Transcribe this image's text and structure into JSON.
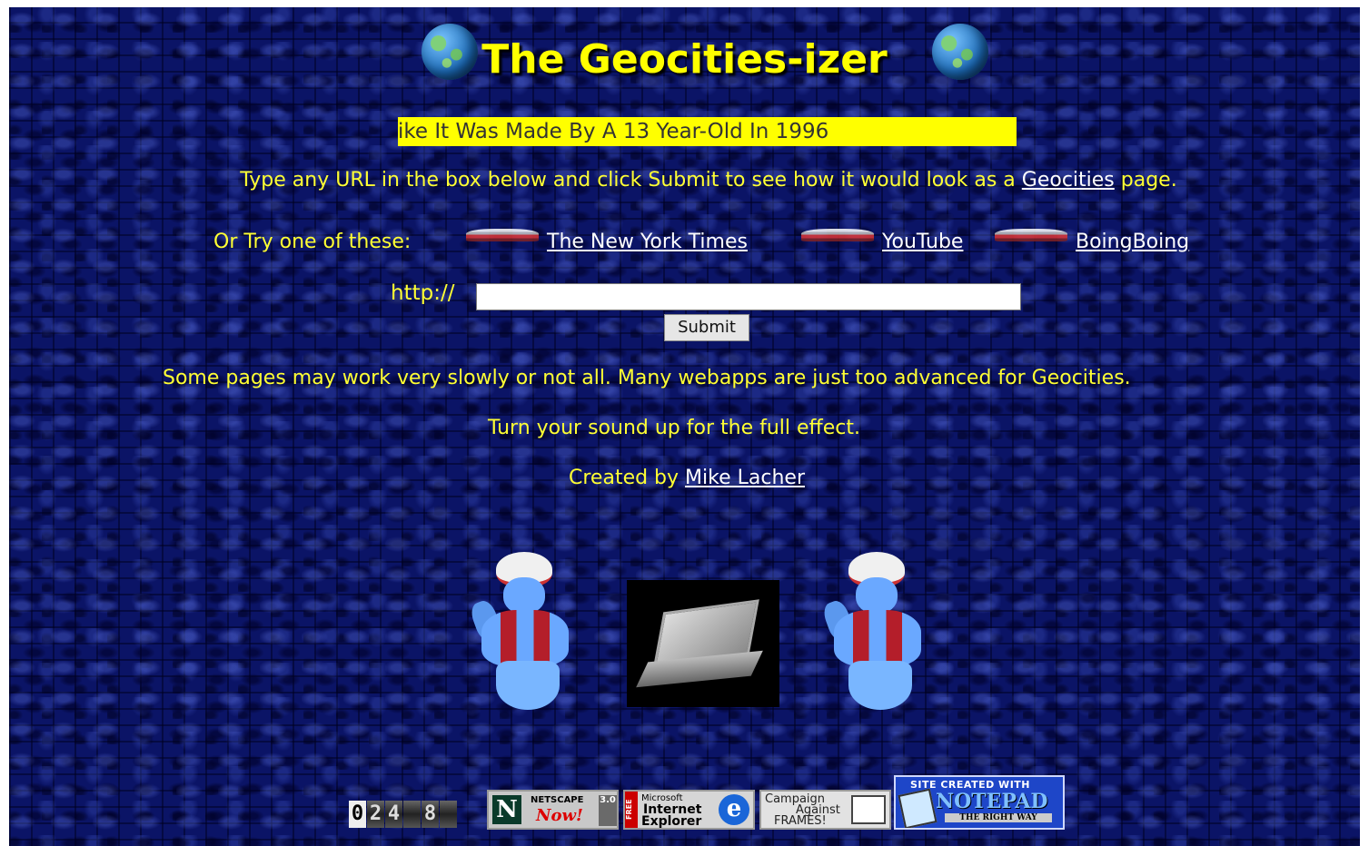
{
  "header": {
    "title": "The Geocities-izer",
    "tagline": "ike It Was Made By A 13 Year-Old In 1996"
  },
  "intro": {
    "before_link": "Type any URL in the box below and click Submit to see how it would look as a ",
    "link": "Geocities",
    "after_link": " page."
  },
  "examples": {
    "label": "Or Try one of these:",
    "links": [
      "The New York Times",
      "YouTube",
      "BoingBoing"
    ]
  },
  "form": {
    "prefix": "http://",
    "url_value": "",
    "submit_label": "Submit"
  },
  "notes": {
    "warning": "Some pages may work very slowly or not all. Many webapps are just too advanced for Geocities.",
    "sound": "Turn your sound up for the full effect.",
    "credit_prefix": "Created by ",
    "credit_link": "Mike Lacher"
  },
  "footer": {
    "counter_digits": [
      "0",
      "2",
      "4",
      "",
      "8",
      ""
    ],
    "netscape": {
      "line1": "NETSCAPE",
      "line2": "Now!",
      "badge": "3.0",
      "logo": "N"
    },
    "ie": {
      "free": "FREE",
      "line1": "Microsoft",
      "line2": "Internet",
      "line3": "Explorer",
      "logo": "e"
    },
    "frames": {
      "line1": "Campaign",
      "line2": "Against",
      "line3": "FRAMES!"
    },
    "notepad": {
      "line1": "SITE CREATED WITH",
      "line2": "NOTEPAD",
      "line3": "THE RIGHT WAY"
    }
  },
  "colors": {
    "background": "#0b1466",
    "text": "#ffff33",
    "marquee_bg": "#ffff00",
    "link": "#ffffff"
  },
  "icons": [
    "globe-icon",
    "genie-gif",
    "laptop-gif",
    "arrow-gif"
  ]
}
